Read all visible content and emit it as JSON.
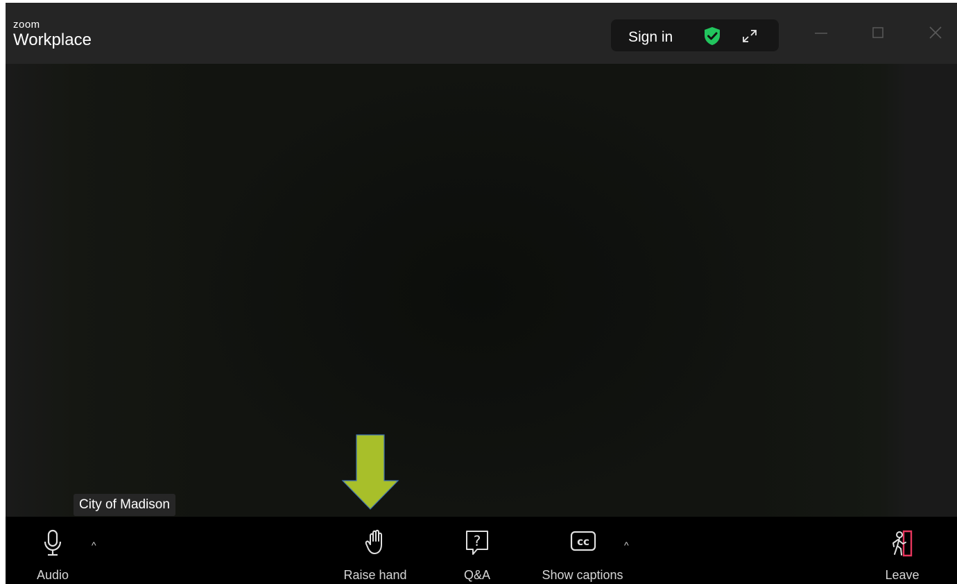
{
  "window": {
    "brand_small": "zoom",
    "brand_big": "Workplace",
    "signin_label": "Sign in",
    "shield_color": "#22c55e"
  },
  "video": {
    "participant_name": "City of Madison",
    "arrow_color": "#a8bf2a"
  },
  "toolbar": {
    "audio_label": "Audio",
    "raise_hand_label": "Raise hand",
    "qa_label": "Q&A",
    "captions_label": "Show captions",
    "captions_icon_text": "cc",
    "qa_icon_text": "?",
    "leave_label": "Leave",
    "leave_accent": "#e8365d"
  }
}
